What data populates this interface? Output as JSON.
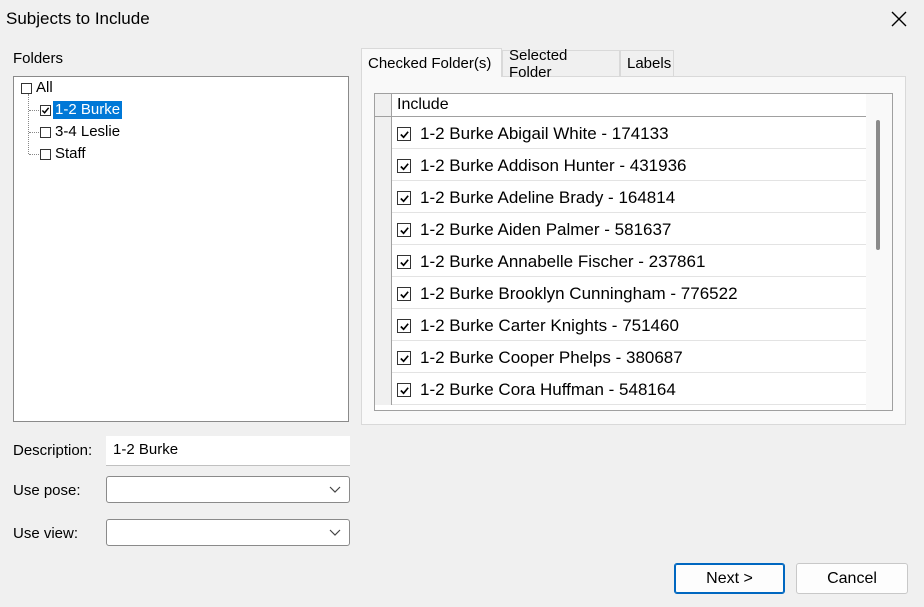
{
  "window": {
    "title": "Subjects to Include"
  },
  "folders": {
    "label": "Folders",
    "items": [
      {
        "label": "All",
        "checked": false,
        "selected": false
      },
      {
        "label": "1-2 Burke",
        "checked": true,
        "selected": true
      },
      {
        "label": "3-4 Leslie",
        "checked": false,
        "selected": false
      },
      {
        "label": "Staff",
        "checked": false,
        "selected": false
      }
    ]
  },
  "form": {
    "description_label": "Description:",
    "description_value": "1-2 Burke",
    "use_pose_label": "Use pose:",
    "use_pose_value": "",
    "use_view_label": "Use view:",
    "use_view_value": ""
  },
  "tabs": [
    {
      "label": "Checked Folder(s)",
      "active": true
    },
    {
      "label": "Selected Folder",
      "active": false
    },
    {
      "label": "Labels",
      "active": false
    }
  ],
  "grid": {
    "header": "Include",
    "rows": [
      {
        "label": "1-2 Burke Abigail White - 174133",
        "checked": true
      },
      {
        "label": "1-2 Burke Addison Hunter - 431936",
        "checked": true
      },
      {
        "label": "1-2 Burke Adeline Brady - 164814",
        "checked": true
      },
      {
        "label": "1-2 Burke Aiden Palmer - 581637",
        "checked": true
      },
      {
        "label": "1-2 Burke Annabelle Fischer - 237861",
        "checked": true
      },
      {
        "label": "1-2 Burke Brooklyn Cunningham - 776522",
        "checked": true
      },
      {
        "label": "1-2 Burke Carter Knights - 751460",
        "checked": true
      },
      {
        "label": "1-2 Burke Cooper Phelps - 380687",
        "checked": true
      },
      {
        "label": "1-2 Burke Cora Huffman - 548164",
        "checked": true
      }
    ]
  },
  "buttons": {
    "next": "Next >",
    "cancel": "Cancel"
  },
  "colors": {
    "selection": "#0078d7",
    "accent_border": "#0067c0"
  }
}
